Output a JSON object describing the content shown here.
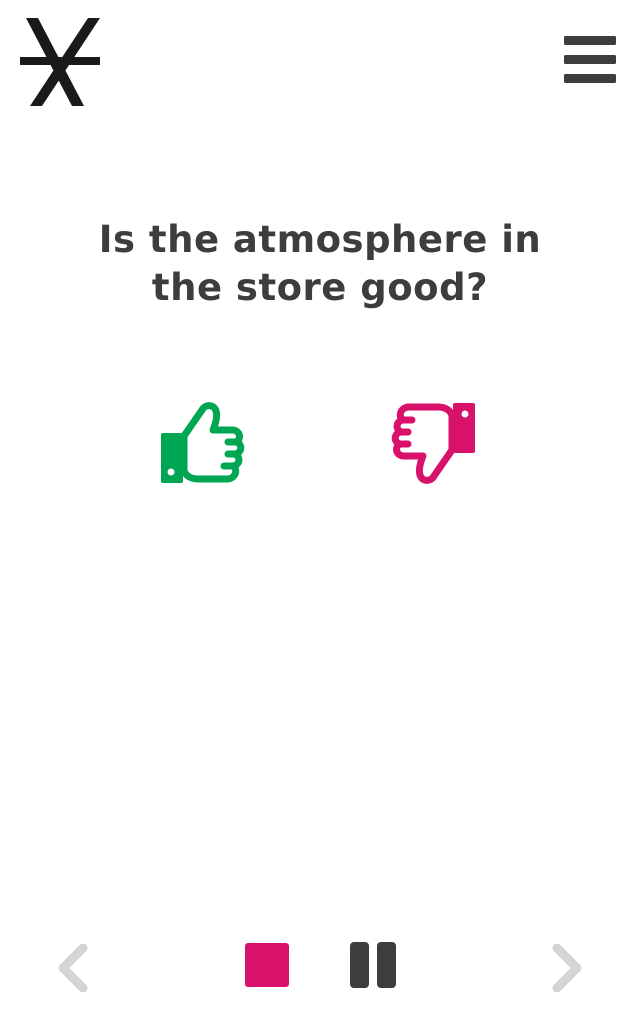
{
  "logo": {
    "icon": "asterisk-logo-icon"
  },
  "header": {
    "menu_icon": "hamburger-menu-icon"
  },
  "question": {
    "line1": "Is the atmosphere in",
    "line2": "the store good?"
  },
  "answers": {
    "positive": {
      "icon": "thumbs-up-icon",
      "color": "#00a651"
    },
    "negative": {
      "icon": "thumbs-down-icon",
      "color": "#d8126b"
    }
  },
  "controls": {
    "previous_icon": "chevron-left-icon",
    "stop_icon": "stop-icon",
    "pause_icon": "pause-icon",
    "next_icon": "chevron-right-icon",
    "stop_color": "#d8126b",
    "arrow_color": "#d4d4d4",
    "text_color": "#3d3d3d"
  }
}
